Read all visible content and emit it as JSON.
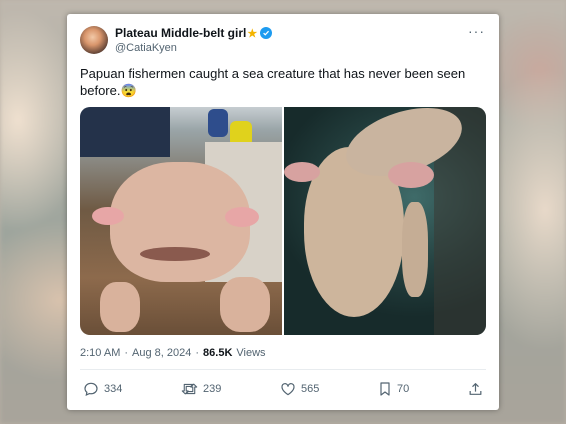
{
  "author": {
    "display_name": "Plateau Middle-belt girl",
    "handle": "@CatiaKyen",
    "star_emoji": "★"
  },
  "menu": {
    "more": "···"
  },
  "tweet": {
    "text": "Papuan fishermen caught a sea creature that has never been seen before.",
    "emoji": "😨"
  },
  "meta": {
    "time": "2:10 AM",
    "separator": "·",
    "date": "Aug 8, 2024",
    "views_count": "86.5K",
    "views_label": "Views"
  },
  "actions": {
    "replies": "334",
    "retweets": "239",
    "likes": "565",
    "bookmarks": "70"
  },
  "icons": {
    "avatar": "avatar",
    "verified": "verified-badge-icon",
    "more": "more-options-icon",
    "reply": "reply-icon",
    "retweet": "retweet-icon",
    "like": "heart-icon",
    "bookmark": "bookmark-icon",
    "share": "share-icon"
  },
  "colors": {
    "verified": "#1d9bf0",
    "star": "#f4b400",
    "text": "#0f1419",
    "secondary": "#536471"
  }
}
